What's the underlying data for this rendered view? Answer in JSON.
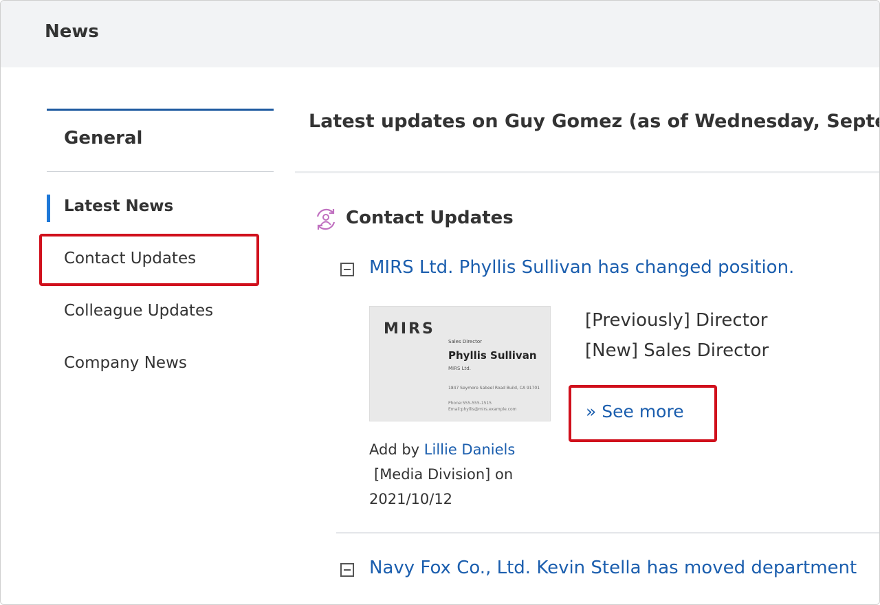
{
  "header": {
    "title": "News"
  },
  "sidebar": {
    "section_title": "General",
    "items": [
      {
        "label": "Latest News",
        "active": true
      },
      {
        "label": "Contact Updates",
        "highlighted": true
      },
      {
        "label": "Colleague Updates"
      },
      {
        "label": "Company News"
      }
    ]
  },
  "main": {
    "heading": "Latest updates on Guy Gomez (as of Wednesday, September",
    "section": {
      "icon": "contact-update-icon",
      "title": "Contact Updates"
    },
    "items": [
      {
        "headline": "MIRS Ltd. Phyllis Sullivan has changed position.",
        "card": {
          "brand": "MIRS",
          "title": "Sales Director",
          "name": "Phyllis Sullivan",
          "company": "MIRS Ltd.",
          "address": "1847 Seymore Sabeel Road Build, CA 91701",
          "phone": "Phone:555-555-1515",
          "email": "Email:phyllis@mirs.example.com"
        },
        "previous": "[Previously] Director",
        "new": "[New] Sales Director",
        "see_more": "» See more",
        "added_prefix": "Add by",
        "added_by": "Lillie Daniels",
        "added_division": "[Media Division] on",
        "added_date": "2021/10/12"
      },
      {
        "headline": "Navy Fox Co., Ltd. Kevin Stella has moved department"
      }
    ]
  },
  "colors": {
    "link": "#1b5eae",
    "highlight": "#d0101c",
    "active_bar": "#1e78d8",
    "top_line": "#1e5aa0"
  }
}
